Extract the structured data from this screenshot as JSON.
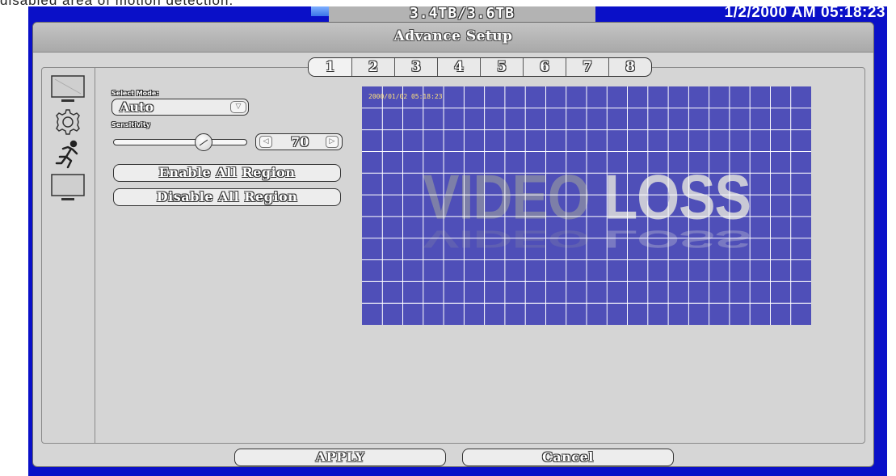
{
  "caption": "disabled  area  of  motion  detection.",
  "status": {
    "disk_usage": "3.4TB/3.6TB",
    "clock": "1/2/2000 AM 05:18:23"
  },
  "window": {
    "title": "Advance Setup"
  },
  "sidebar": {
    "items": [
      {
        "icon": "monitor-icon"
      },
      {
        "icon": "gear-icon"
      },
      {
        "icon": "running-man-icon"
      },
      {
        "icon": "monitor-icon"
      }
    ]
  },
  "channel_tabs": [
    "1",
    "2",
    "3",
    "4",
    "5",
    "6",
    "7",
    "8"
  ],
  "active_channel": "1",
  "motion": {
    "select_mode_label": "Select Mode:",
    "mode_value": "Auto",
    "sensitivity_label": "Sensitivity",
    "sensitivity": 70,
    "sensitivity_display": "70",
    "slider_fraction": 0.7,
    "enable_all_label": "Enable All Region",
    "disable_all_label": "Disable All Region"
  },
  "video": {
    "timestamp": "2000/01/02 05:18:23",
    "overlay_word1": "VIDEO",
    "overlay_word2": "LOSS",
    "grid_columns": 22,
    "grid_rows": 11,
    "grid_color": "#ffffff",
    "background_color": "#4f4fb8"
  },
  "actions": {
    "apply_label": "APPLY",
    "cancel_label": "Cancel"
  },
  "colors": {
    "frame": "#0a10c8",
    "panel": "#d6d6d6"
  }
}
